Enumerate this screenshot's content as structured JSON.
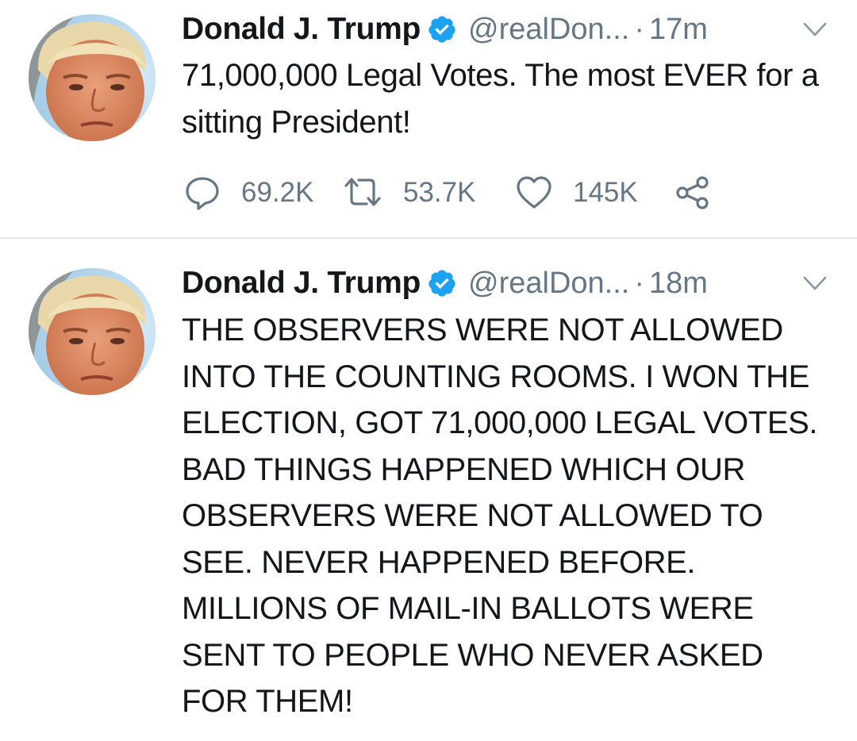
{
  "colors": {
    "text_primary": "#14171a",
    "text_secondary": "#657786",
    "verified_blue": "#1da1f2",
    "divider": "#e1e8ed"
  },
  "tweets": [
    {
      "author_name": "Donald J. Trump",
      "handle": "@realDon...",
      "separator": "·",
      "time": "17m",
      "verified_icon": "verified-badge-icon",
      "text": "71,000,000 Legal Votes. The most EVER for a sitting President!",
      "stats": {
        "replies": "69.2K",
        "retweets": "53.7K",
        "likes": "145K"
      }
    },
    {
      "author_name": "Donald J. Trump",
      "handle": "@realDon...",
      "separator": "·",
      "time": "18m",
      "verified_icon": "verified-badge-icon",
      "text": "THE OBSERVERS WERE NOT ALLOWED INTO THE COUNTING ROOMS. I WON THE ELECTION, GOT 71,000,000 LEGAL VOTES. BAD THINGS HAPPENED WHICH OUR OBSERVERS WERE NOT ALLOWED TO SEE. NEVER HAPPENED BEFORE. MILLIONS OF MAIL-IN BALLOTS WERE SENT TO PEOPLE WHO NEVER ASKED FOR THEM!"
    }
  ]
}
